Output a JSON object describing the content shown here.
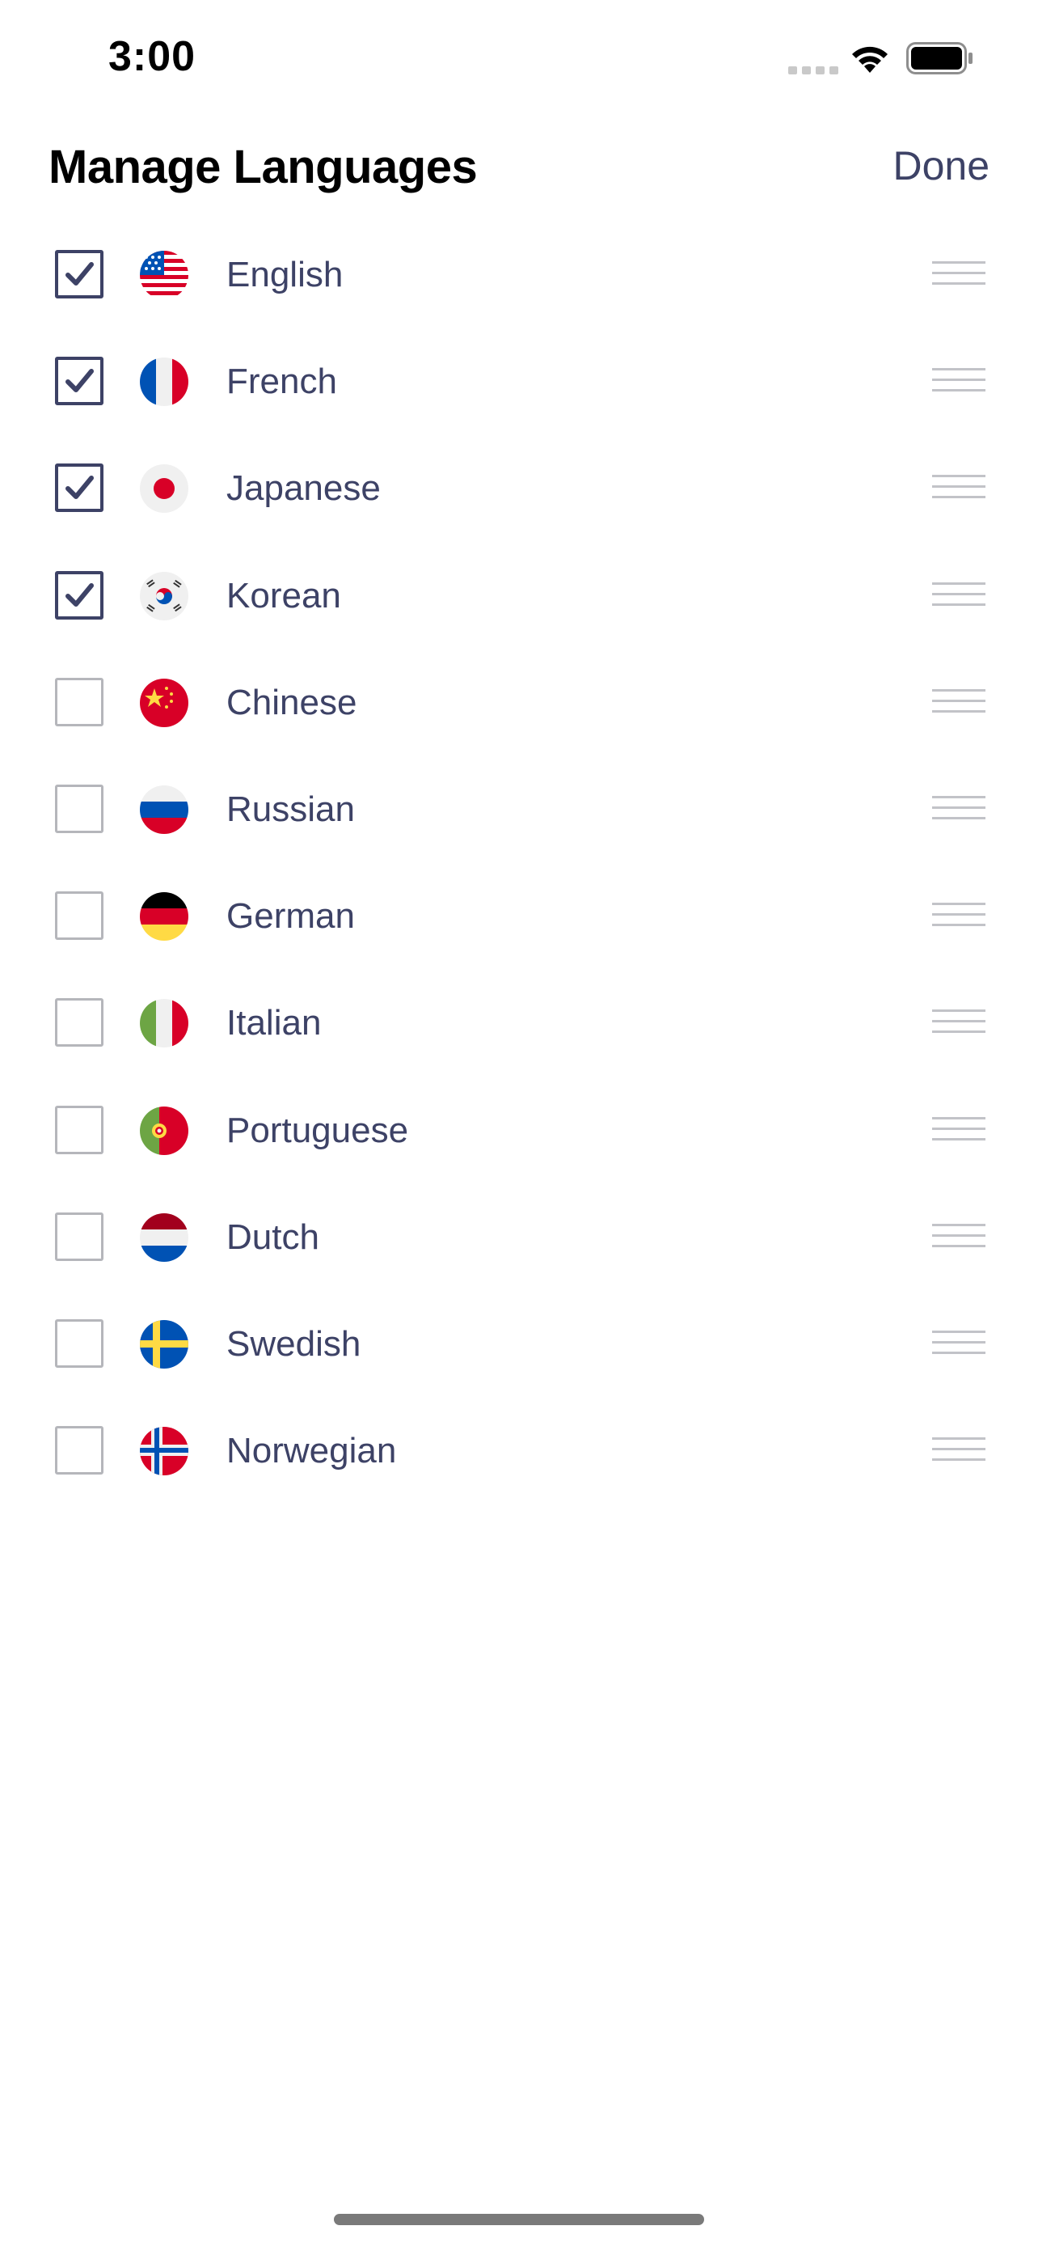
{
  "status_bar": {
    "time": "3:00",
    "icons": [
      "signal-icon",
      "wifi-icon",
      "battery-icon"
    ]
  },
  "header": {
    "title": "Manage Languages",
    "done_label": "Done"
  },
  "colors": {
    "accent": "#3d4266",
    "checkbox_unchecked_border": "#b5b6bb",
    "drag_handle": "#c2c3c8"
  },
  "languages": [
    {
      "name": "English",
      "checked": true,
      "flag": "us-flag-icon"
    },
    {
      "name": "French",
      "checked": true,
      "flag": "france-flag-icon"
    },
    {
      "name": "Japanese",
      "checked": true,
      "flag": "japan-flag-icon"
    },
    {
      "name": "Korean",
      "checked": true,
      "flag": "korea-flag-icon"
    },
    {
      "name": "Chinese",
      "checked": false,
      "flag": "china-flag-icon"
    },
    {
      "name": "Russian",
      "checked": false,
      "flag": "russia-flag-icon"
    },
    {
      "name": "German",
      "checked": false,
      "flag": "germany-flag-icon"
    },
    {
      "name": "Italian",
      "checked": false,
      "flag": "italy-flag-icon"
    },
    {
      "name": "Portuguese",
      "checked": false,
      "flag": "portugal-flag-icon"
    },
    {
      "name": "Dutch",
      "checked": false,
      "flag": "netherlands-flag-icon"
    },
    {
      "name": "Swedish",
      "checked": false,
      "flag": "sweden-flag-icon"
    },
    {
      "name": "Norwegian",
      "checked": false,
      "flag": "norway-flag-icon"
    }
  ]
}
